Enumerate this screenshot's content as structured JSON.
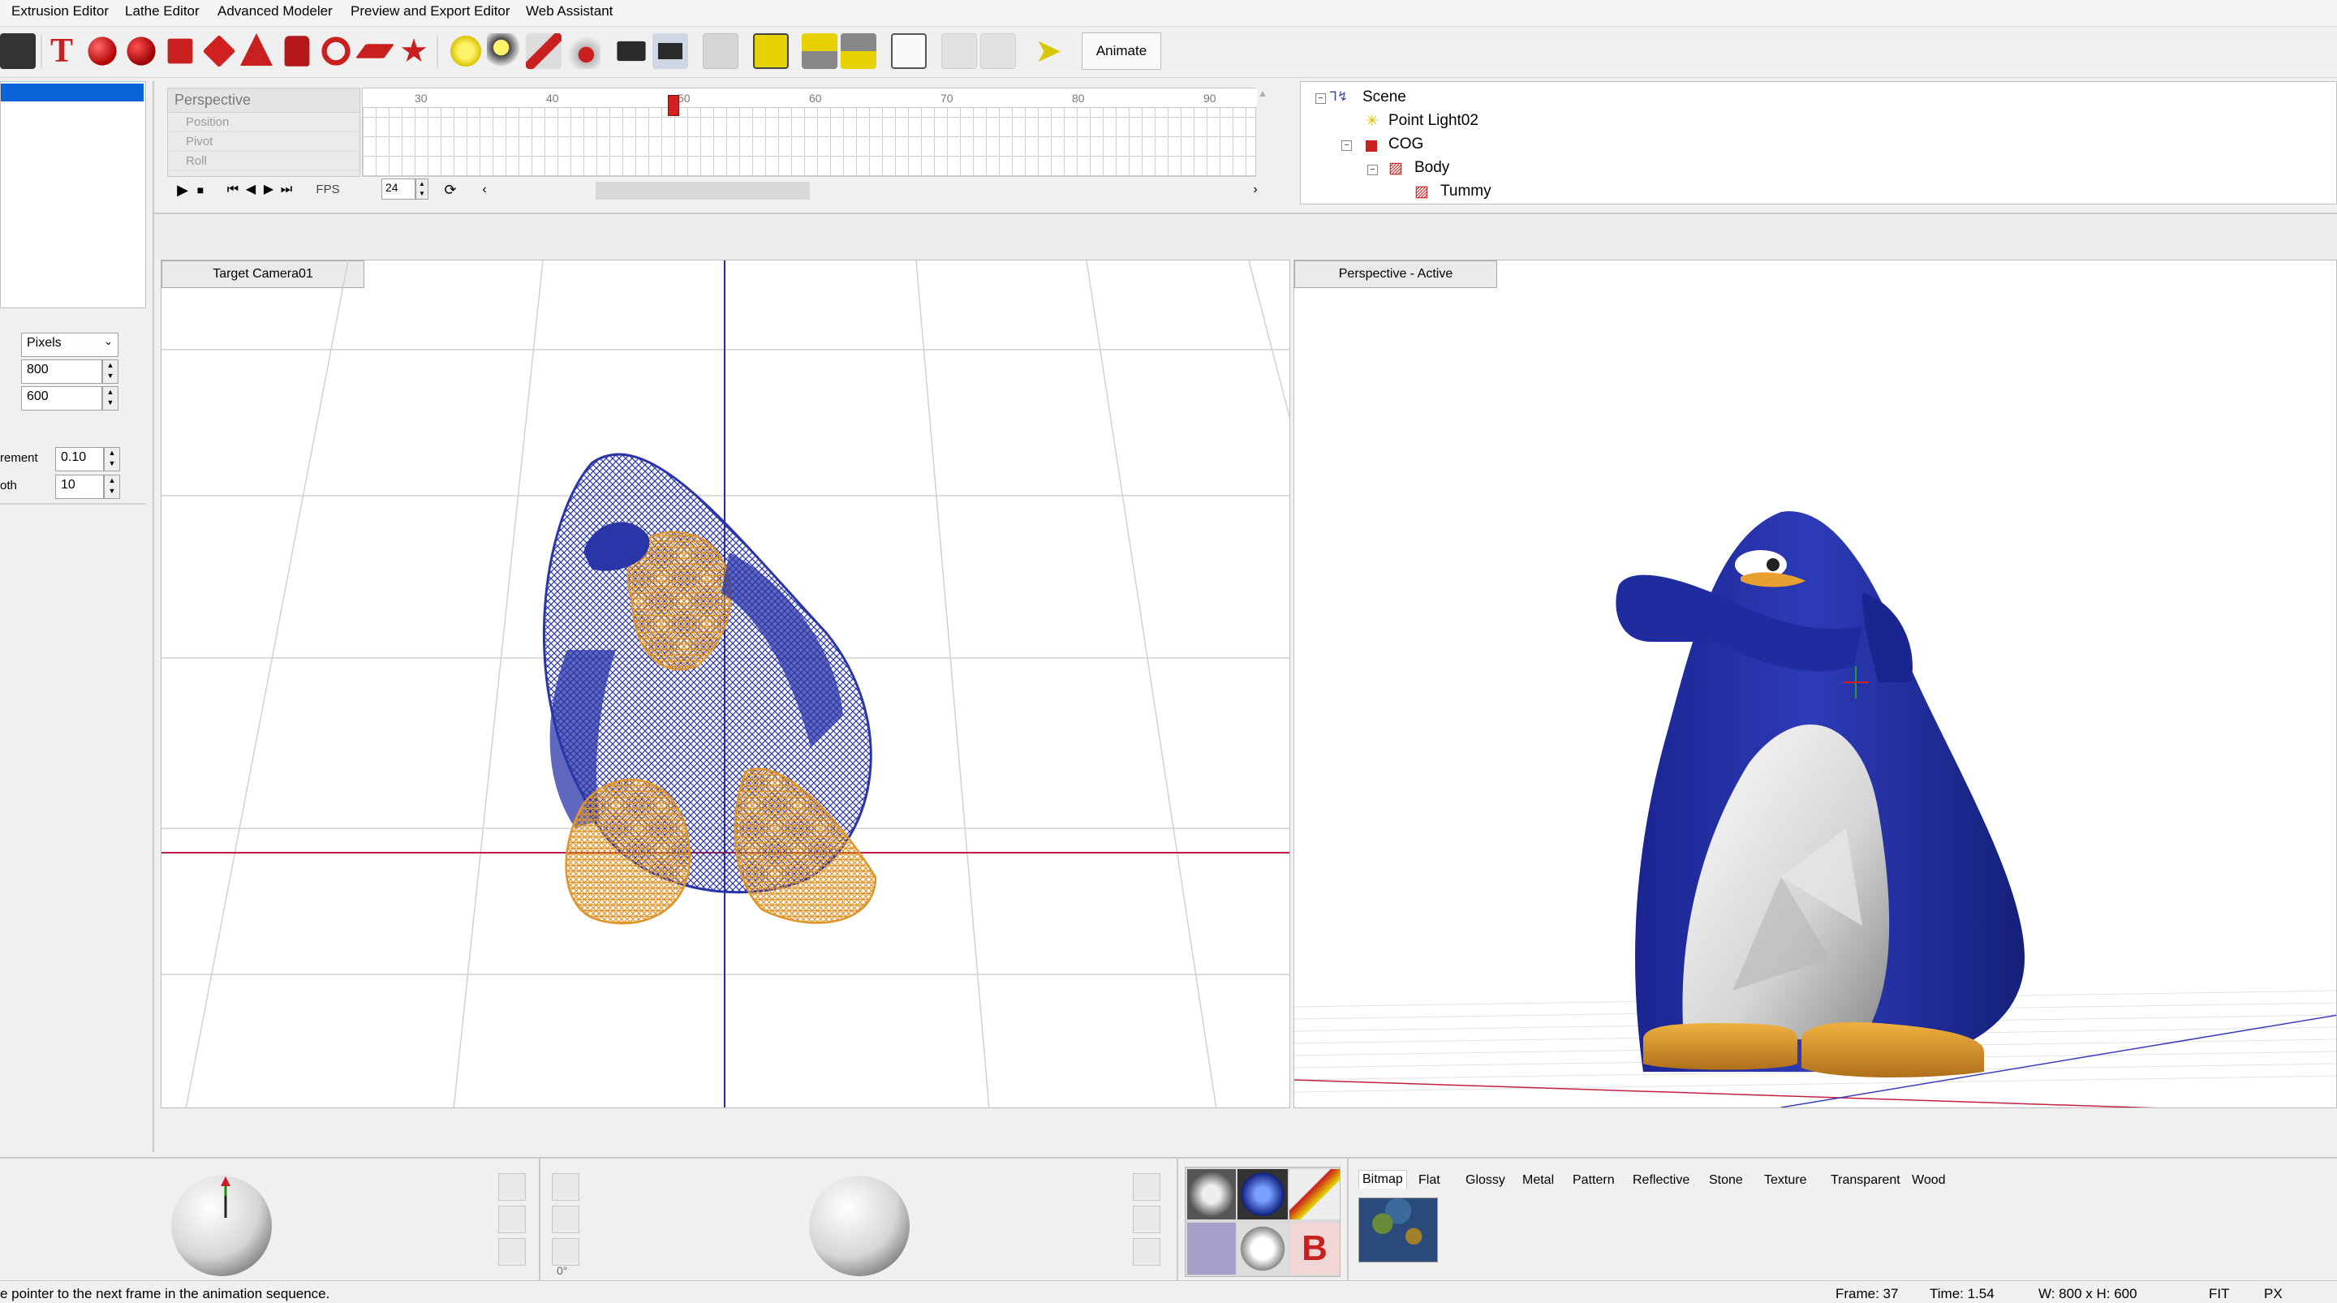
{
  "menu": [
    "Extrusion Editor",
    "Lathe Editor",
    "Advanced Modeler",
    "Preview and Export Editor",
    "Web Assistant"
  ],
  "toolbar": {
    "animate_label": "Animate"
  },
  "left_panel": {
    "units": "Pixels",
    "width": "800",
    "height": "600",
    "increment_label": "rement",
    "increment": "0.10",
    "smooth_label": "oth",
    "smooth": "10"
  },
  "timeline": {
    "label": "Perspective",
    "tracks": [
      "Position",
      "Pivot",
      "Roll"
    ],
    "ticks": [
      "30",
      "40",
      "50",
      "60",
      "70",
      "80",
      "90"
    ],
    "fps_label": "FPS",
    "fps": "24"
  },
  "scene_tree": {
    "items": [
      "Scene",
      "Point Light02",
      "COG",
      "Body",
      "Tummy"
    ]
  },
  "viewports": {
    "left_label": "Target Camera01",
    "right_label": "Perspective - Active"
  },
  "materials": {
    "tabs": [
      "Bitmap",
      "Flat",
      "Glossy",
      "Metal",
      "Pattern",
      "Reflective",
      "Stone",
      "Texture",
      "Transparent",
      "Wood"
    ]
  },
  "rotation": {
    "angle": "0°"
  },
  "status": {
    "hint": "e pointer to the next frame in the animation sequence.",
    "frame": "Frame: 37",
    "time": "Time: 1.54",
    "size": "W: 800 x H: 600",
    "fit": "FIT",
    "px": "PX"
  },
  "colors": {
    "selection": "#0a64d8",
    "penguin_blue": "#2a35a8",
    "wire_orange": "#e0952a",
    "feet": "#e8a030"
  }
}
